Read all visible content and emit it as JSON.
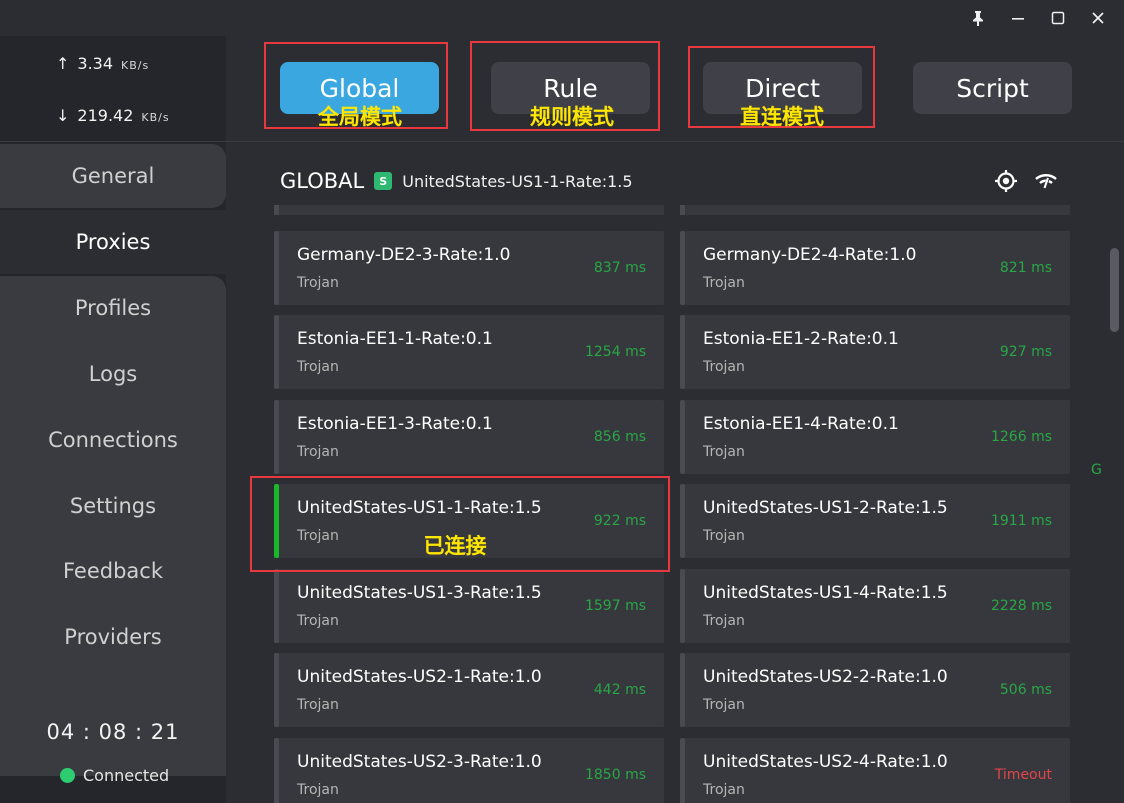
{
  "window": {
    "pin_icon": "pin-icon",
    "minimize_icon": "minimize-icon",
    "maximize_icon": "maximize-icon",
    "close_icon": "close-icon"
  },
  "traffic": {
    "up_arrow": "↑",
    "up_value": "3.34",
    "up_unit": "KB/s",
    "down_arrow": "↓",
    "down_value": "219.42",
    "down_unit": "KB/s"
  },
  "nav": {
    "items": [
      {
        "label": "General"
      },
      {
        "label": "Proxies"
      },
      {
        "label": "Profiles"
      },
      {
        "label": "Logs"
      },
      {
        "label": "Connections"
      },
      {
        "label": "Settings"
      },
      {
        "label": "Feedback"
      },
      {
        "label": "Providers"
      }
    ],
    "active": "Proxies"
  },
  "status": {
    "uptime": "04 : 08 : 21",
    "connection": "Connected",
    "connection_color": "#2ecc71"
  },
  "modes": {
    "items": [
      {
        "label": "Global",
        "annotation": "全局模式"
      },
      {
        "label": "Rule",
        "annotation": "规则模式"
      },
      {
        "label": "Direct",
        "annotation": "直连模式"
      },
      {
        "label": "Script",
        "annotation": ""
      }
    ],
    "active": "Global",
    "accent": "#3aa7e0"
  },
  "group": {
    "title": "GLOBAL",
    "badge": "S",
    "selected": "UnitedStates-US1-1-Rate:1.5",
    "locate_icon": "crosshair-icon",
    "speedtest_icon": "wifi-speed-icon"
  },
  "proxies": [
    {
      "name": "Germany-DE2-3-Rate:1.0",
      "type": "Trojan",
      "latency": "837 ms"
    },
    {
      "name": "Germany-DE2-4-Rate:1.0",
      "type": "Trojan",
      "latency": "821 ms"
    },
    {
      "name": "Estonia-EE1-1-Rate:0.1",
      "type": "Trojan",
      "latency": "1254 ms"
    },
    {
      "name": "Estonia-EE1-2-Rate:0.1",
      "type": "Trojan",
      "latency": "927 ms"
    },
    {
      "name": "Estonia-EE1-3-Rate:0.1",
      "type": "Trojan",
      "latency": "856 ms"
    },
    {
      "name": "Estonia-EE1-4-Rate:0.1",
      "type": "Trojan",
      "latency": "1266 ms"
    },
    {
      "name": "UnitedStates-US1-1-Rate:1.5",
      "type": "Trojan",
      "latency": "922 ms",
      "selected": true
    },
    {
      "name": "UnitedStates-US1-2-Rate:1.5",
      "type": "Trojan",
      "latency": "1911 ms"
    },
    {
      "name": "UnitedStates-US1-3-Rate:1.5",
      "type": "Trojan",
      "latency": "1597 ms"
    },
    {
      "name": "UnitedStates-US1-4-Rate:1.5",
      "type": "Trojan",
      "latency": "2228 ms"
    },
    {
      "name": "UnitedStates-US2-1-Rate:1.0",
      "type": "Trojan",
      "latency": "442 ms"
    },
    {
      "name": "UnitedStates-US2-2-Rate:1.0",
      "type": "Trojan",
      "latency": "506 ms"
    },
    {
      "name": "UnitedStates-US2-3-Rate:1.0",
      "type": "Trojan",
      "latency": "1850 ms"
    },
    {
      "name": "UnitedStates-US2-4-Rate:1.0",
      "type": "Trojan",
      "latency": "Timeout",
      "timeout": true
    }
  ],
  "selected_annotation": "已连接",
  "side_letter": "G",
  "colors": {
    "latency_ok": "#28a745",
    "latency_timeout": "#e0454a",
    "annotation_border": "#e8383d",
    "annotation_text": "#ffe600"
  }
}
